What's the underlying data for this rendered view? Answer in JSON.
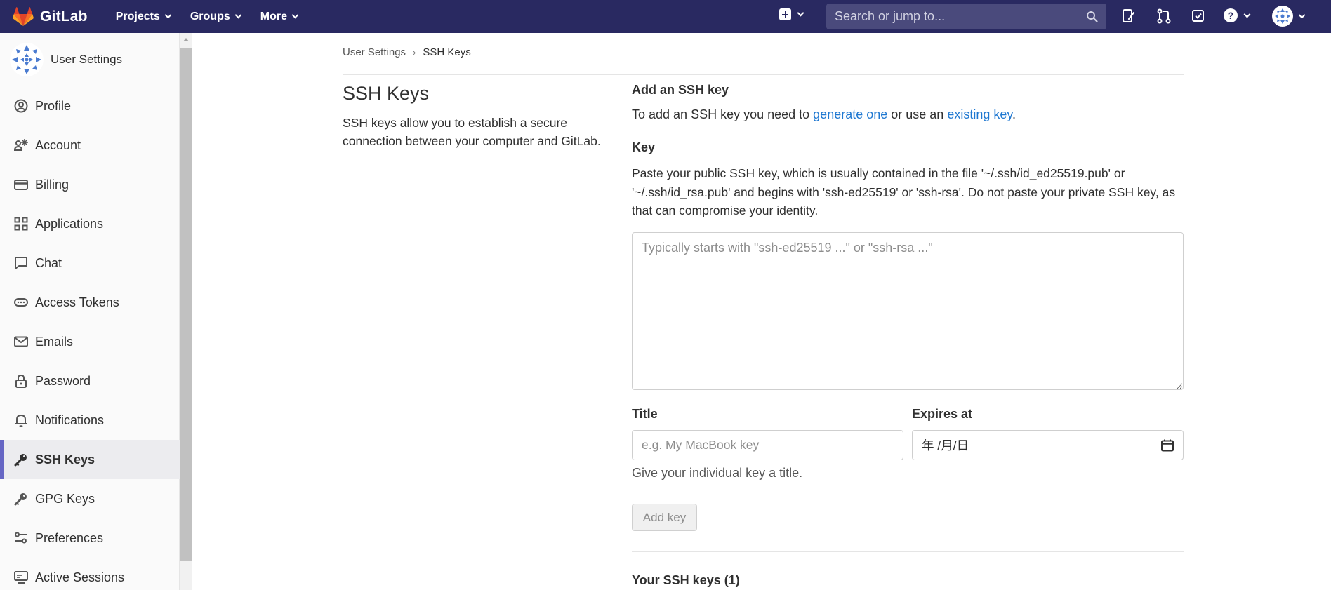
{
  "navbar": {
    "brand": "GitLab",
    "menu": [
      {
        "label": "Projects"
      },
      {
        "label": "Groups"
      },
      {
        "label": "More"
      }
    ],
    "search_placeholder": "Search or jump to..."
  },
  "sidebar": {
    "title": "User Settings",
    "items": [
      {
        "label": "Profile",
        "icon": "profile-icon"
      },
      {
        "label": "Account",
        "icon": "account-icon"
      },
      {
        "label": "Billing",
        "icon": "billing-icon"
      },
      {
        "label": "Applications",
        "icon": "applications-icon"
      },
      {
        "label": "Chat",
        "icon": "chat-icon"
      },
      {
        "label": "Access Tokens",
        "icon": "access-tokens-icon"
      },
      {
        "label": "Emails",
        "icon": "emails-icon"
      },
      {
        "label": "Password",
        "icon": "lock-icon"
      },
      {
        "label": "Notifications",
        "icon": "bell-icon"
      },
      {
        "label": "SSH Keys",
        "icon": "key-icon",
        "active": true
      },
      {
        "label": "GPG Keys",
        "icon": "key-icon"
      },
      {
        "label": "Preferences",
        "icon": "preferences-icon"
      },
      {
        "label": "Active Sessions",
        "icon": "monitor-icon"
      }
    ]
  },
  "breadcrumb": {
    "parent": "User Settings",
    "current": "SSH Keys"
  },
  "page": {
    "title": "SSH Keys",
    "description": "SSH keys allow you to establish a secure connection between your computer and GitLab."
  },
  "form": {
    "section_title": "Add an SSH key",
    "intro_prefix": "To add an SSH key you need to ",
    "intro_link1": "generate one",
    "intro_middle": " or use an ",
    "intro_link2": "existing key",
    "intro_suffix": ".",
    "key_label": "Key",
    "key_help": "Paste your public SSH key, which is usually contained in the file '~/.ssh/id_ed25519.pub' or '~/.ssh/id_rsa.pub' and begins with 'ssh-ed25519' or 'ssh-rsa'. Do not paste your private SSH key, as that can compromise your identity.",
    "key_placeholder": "Typically starts with \"ssh-ed25519 ...\" or \"ssh-rsa ...\"",
    "title_label": "Title",
    "title_placeholder": "e.g. My MacBook key",
    "title_help": "Give your individual key a title.",
    "expires_label": "Expires at",
    "expires_value": "年 /月/日",
    "add_button": "Add key"
  },
  "keys_list": {
    "title": "Your SSH keys (1)"
  },
  "colors": {
    "navbar": "#292961",
    "link": "#1f78d1",
    "active_indicator": "#6666c4"
  }
}
